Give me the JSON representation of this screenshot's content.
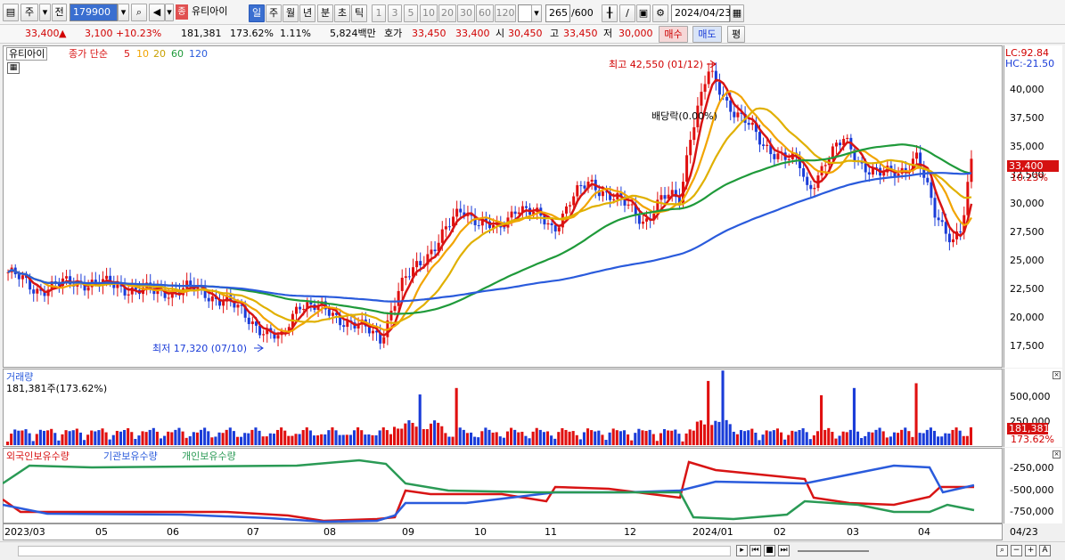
{
  "toolbar": {
    "mode": "주",
    "prev": "전",
    "code": "179900",
    "stock_badge": "종",
    "stock_name": "유티아이",
    "periods": [
      "일",
      "주",
      "월",
      "년",
      "분",
      "초",
      "틱"
    ],
    "intervals": [
      "1",
      "3",
      "5",
      "10",
      "20",
      "30",
      "60",
      "120"
    ],
    "count": "265",
    "count_total": "/600",
    "date": "2024/04/23"
  },
  "quote": {
    "price": "33,400",
    "change_arrow": "▲",
    "change": "3,100",
    "change_pct": "+10.23%",
    "volume": "181,381",
    "volume_ratio": "173.62%",
    "turnover": "1.11%",
    "amount": "5,824백만",
    "bid_label": "호가",
    "bid": "33,450",
    "ask": "33,400",
    "open_label": "시",
    "open": "30,450",
    "high_label": "고",
    "high": "33,450",
    "low_label": "저",
    "low": "30,000",
    "buy_label": "매수",
    "sell_label": "매도",
    "flat_label": "평"
  },
  "price_panel": {
    "name": "유티아이",
    "ma_title": "종가 단순",
    "ma_periods": [
      "5",
      "10",
      "20",
      "60",
      "120"
    ],
    "ma_colors": [
      "#d81414",
      "#f2a400",
      "#e0b000",
      "#1f9a3a",
      "#2a5bdc"
    ],
    "lc": "LC:92.84",
    "hc": "HC:-21.50",
    "high_note": "최고 42,550 (01/12)",
    "low_note": "최저 17,320 (07/10)",
    "div_note": "배당락(0.00%)",
    "price_badge": "33,400",
    "pct_badge": "10.23%",
    "ticks": [
      "40,000",
      "37,500",
      "35,000",
      "32,500",
      "30,000",
      "27,500",
      "25,000",
      "22,500",
      "20,000",
      "17,500"
    ]
  },
  "volume_panel": {
    "title": "거래량",
    "value": "181,381주(173.62%)",
    "ticks": [
      "500,000",
      "250,000"
    ],
    "badge": "181,381",
    "pct": "173.62%"
  },
  "holder_panel": {
    "series": [
      "외국인보유수량",
      "기관보유수량",
      "개인보유수량"
    ],
    "colors": [
      "#d81414",
      "#2a5bdc",
      "#2a9a55"
    ],
    "ticks": [
      "-250,000",
      "-500,000",
      "-750,000"
    ]
  },
  "x_labels": [
    "2023/03",
    "05",
    "06",
    "07",
    "08",
    "09",
    "10",
    "11",
    "12",
    "2024/01",
    "02",
    "03",
    "04",
    "04/23"
  ],
  "chart_data": {
    "type": "candlestick",
    "y_range": [
      16500,
      43000
    ],
    "price_path": [
      [
        0,
        24000
      ],
      [
        3,
        22500
      ],
      [
        8,
        23200
      ],
      [
        12,
        22800
      ],
      [
        16,
        22200
      ],
      [
        20,
        22600
      ],
      [
        24,
        21500
      ],
      [
        28,
        19000
      ],
      [
        30,
        17900
      ],
      [
        32,
        21500
      ],
      [
        35,
        20500
      ],
      [
        38,
        19500
      ],
      [
        41,
        18200
      ],
      [
        43,
        22500
      ],
      [
        46,
        25500
      ],
      [
        48,
        27500
      ],
      [
        50,
        29500
      ],
      [
        52,
        28500
      ],
      [
        54,
        27500
      ],
      [
        56,
        30000
      ],
      [
        58,
        29000
      ],
      [
        60,
        27800
      ],
      [
        62,
        30500
      ],
      [
        64,
        31800
      ],
      [
        66,
        31000
      ],
      [
        68,
        29800
      ],
      [
        70,
        28500
      ],
      [
        72,
        30500
      ],
      [
        74,
        30500
      ],
      [
        75,
        36000
      ],
      [
        77,
        41500
      ],
      [
        79,
        39000
      ],
      [
        81,
        37500
      ],
      [
        83,
        35000
      ],
      [
        85,
        34500
      ],
      [
        87,
        33500
      ],
      [
        88,
        31000
      ],
      [
        90,
        34000
      ],
      [
        92,
        35500
      ],
      [
        94,
        33500
      ],
      [
        96,
        32500
      ],
      [
        98,
        32800
      ],
      [
        100,
        34200
      ],
      [
        102,
        29000
      ],
      [
        104,
        27000
      ],
      [
        105,
        28000
      ],
      [
        106,
        33400
      ]
    ],
    "high": {
      "label": "최고 42,550 (01/12)",
      "value": 42550
    },
    "low": {
      "label": "최저 17,320 (07/10)",
      "value": 17320
    }
  }
}
